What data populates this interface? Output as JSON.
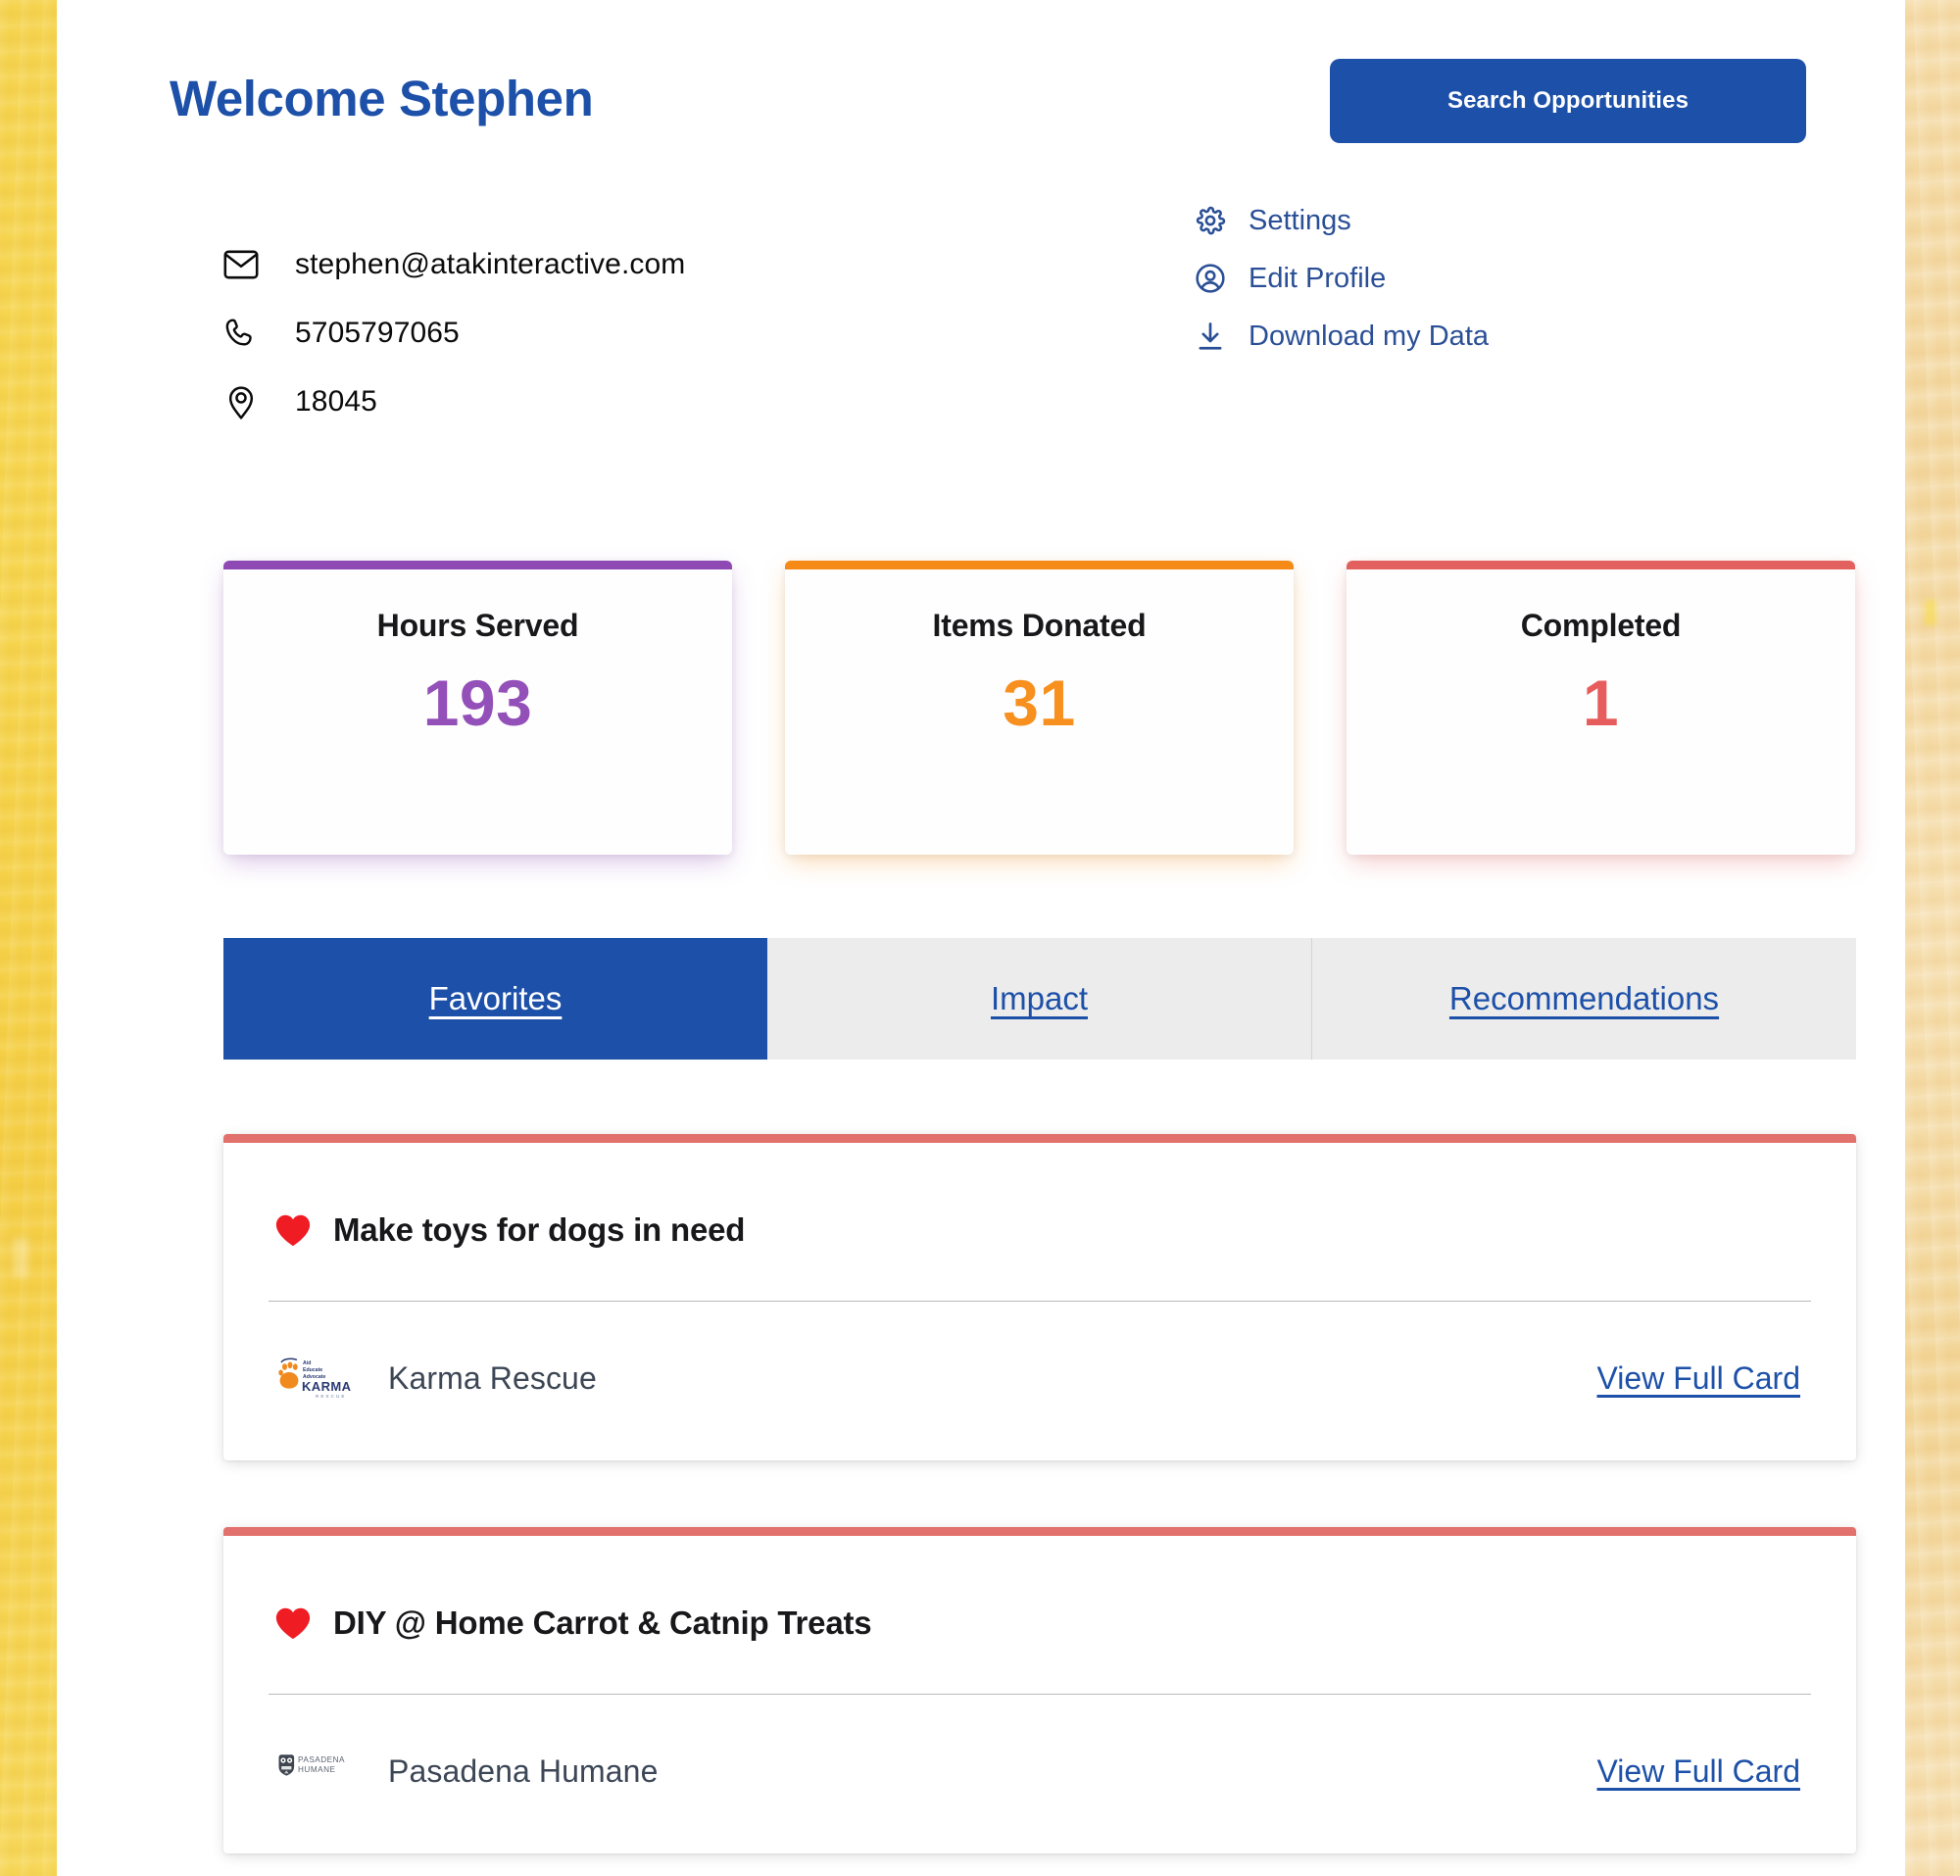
{
  "header": {
    "welcome_title": "Welcome Stephen",
    "search_button_label": "Search Opportunities"
  },
  "contact": {
    "email": "stephen@atakinteractive.com",
    "phone": "5705797065",
    "zip": "18045",
    "email_icon": "envelope-icon",
    "phone_icon": "phone-icon",
    "location_icon": "map-pin-icon"
  },
  "account_links": [
    {
      "label": "Settings",
      "icon": "gear-icon"
    },
    {
      "label": "Edit Profile",
      "icon": "user-circle-icon"
    },
    {
      "label": "Download my Data",
      "icon": "download-icon"
    }
  ],
  "stats": [
    {
      "label": "Hours Served",
      "value": "193",
      "color": "#9450b9",
      "bar_color": "#8f49b5"
    },
    {
      "label": "Items Donated",
      "value": "31",
      "color": "#f7901e",
      "bar_color": "#f58a16"
    },
    {
      "label": "Completed",
      "value": "1",
      "color": "#e75d5d",
      "bar_color": "#e2615f"
    }
  ],
  "tabs": [
    {
      "label": "Favorites",
      "active": true
    },
    {
      "label": "Impact",
      "active": false
    },
    {
      "label": "Recommendations",
      "active": false
    }
  ],
  "favorites": [
    {
      "title": "Make toys for dogs in need",
      "heart_icon": "heart-icon",
      "org_name": "Karma Rescue",
      "org_logo": "karma-rescue-logo",
      "view_label": "View Full Card",
      "accent_color": "#e2716d"
    },
    {
      "title": "DIY @ Home Carrot & Catnip Treats",
      "heart_icon": "heart-icon",
      "org_name": "Pasadena Humane",
      "org_logo": "pasadena-humane-logo",
      "view_label": "View Full Card",
      "accent_color": "#e2716d"
    }
  ],
  "theme": {
    "brand_blue": "#1d50a8",
    "page_edge_yellow": "#f6d551",
    "tab_inactive_bg": "#ececec"
  }
}
